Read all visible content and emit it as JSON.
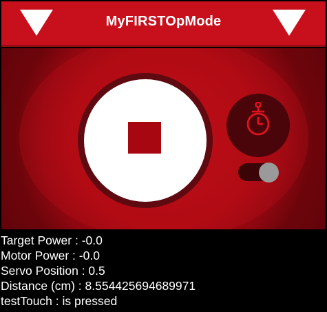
{
  "header": {
    "title": "MyFIRSTOpMode",
    "left_icon": "chevron-down-icon",
    "right_icon": "chevron-down-icon"
  },
  "controls": {
    "start_stop_icon": "stop-icon",
    "timer_icon": "stopwatch-icon",
    "timer_toggle": {
      "enabled": true
    }
  },
  "telemetry": {
    "lines": [
      "Target Power : -0.0",
      "Motor Power : -0.0",
      "Servo Position : 0.5",
      "Distance (cm) : 8.554425694689971",
      "testTouch : is pressed"
    ]
  },
  "colors": {
    "brand_red": "#c8101d",
    "stop_red": "#a70710",
    "background": "#000000"
  }
}
